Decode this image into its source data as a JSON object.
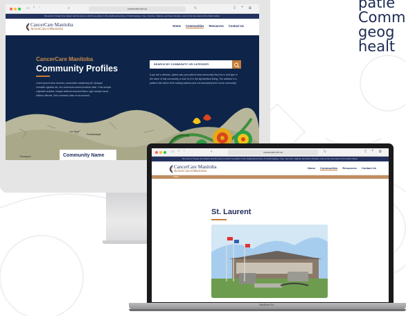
{
  "side_caption": [
    "patie",
    "Comm",
    "geog",
    "healt"
  ],
  "desktop": {
    "browser_url": "cancercare.mb.ca",
    "acknowledgement": "We work in Treaty One Nation and the land on which we gather is the traditional territory of Anishinaabeg, Cree, Oji-Cree, Dakota, and Dene Peoples, and on the homeland of the Métis Nation.",
    "logo_primary": "CancerCare Manitoba",
    "logo_secondary": "ActionCancerManitoba",
    "nav": [
      "Home",
      "Communities",
      "Resources",
      "Contact Us"
    ],
    "active_nav": "Communities",
    "hero_eyebrow": "CancerCare Manitoba",
    "hero_title": "Community Profiles",
    "hero_body": "Lorem ipsum dolor sit amet, consectetur adipiscing elit. Quisque convallis egestas est, nec commodo mauris tincidunt vitae. Cras semper vulputate sodales. Integer eleifend euismod libero, eget semper lacus efficitur ultricies. Sed commodo vitae mi at euismod.",
    "search_label": "SEARCH BY COMMUNITY OR CATEGORY",
    "search_help": "If you are a clinician, please ask your patient what community they live in and type in the name of that community or look for it in the alphabetical listing. The address in a patient's file will be their mailing address and not necessarily their home community.",
    "map_labels": [
      "Lac Seul",
      "Pukatawagan",
      "Thompson"
    ],
    "map_card_title": "Community Name"
  },
  "laptop": {
    "browser_url": "cancercare.mb.ca",
    "acknowledgement": "We work in Treaty One Nation and the land on which we gather is the traditional territory of Anishinaabeg, Cree, Oji-Cree, Dakota, and Dene Peoples, and on the homeland of the Métis Nation.",
    "back_link": "< Back",
    "logo_primary": "CancerCare Manitoba",
    "logo_secondary": "ActionCancerManitoba",
    "nav": [
      "Home",
      "Communities",
      "Resources",
      "Contact Us"
    ],
    "community_title": "St. Laurent",
    "device_label": "MacBook Pro"
  },
  "colors": {
    "navy": "#0e2549",
    "accent": "#c67b38",
    "title_blue": "#1f2c5a"
  }
}
